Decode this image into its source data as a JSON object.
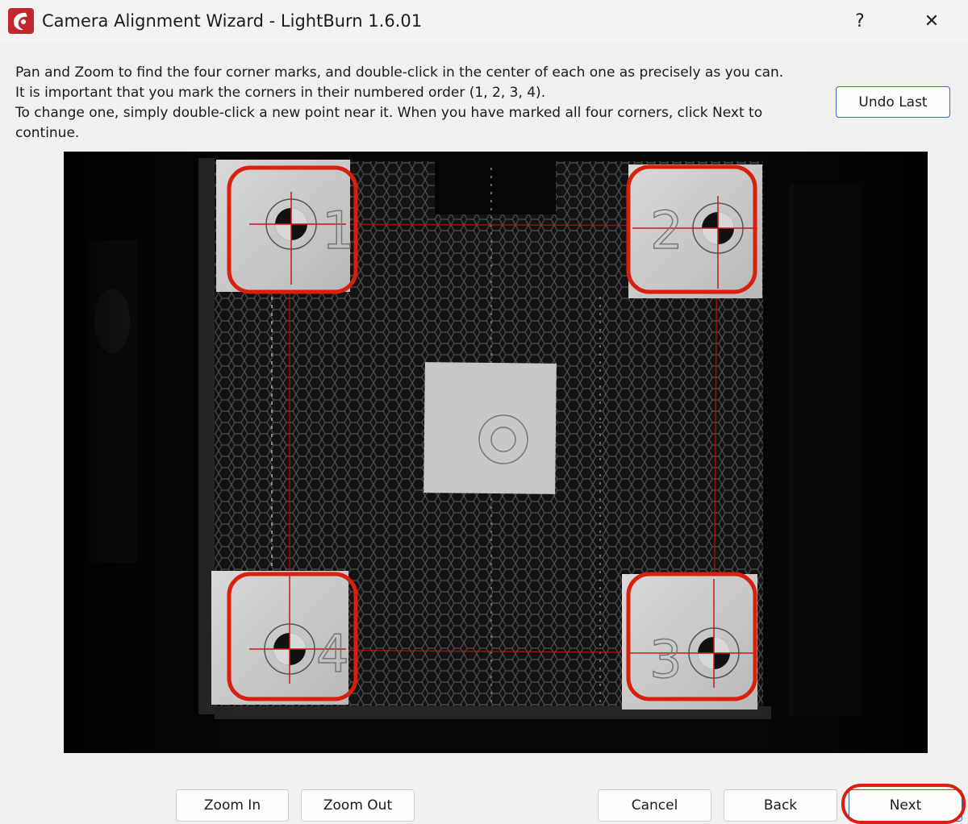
{
  "window": {
    "title": "Camera Alignment Wizard - LightBurn 1.6.01",
    "help_label": "?",
    "close_label": "✕"
  },
  "instructions": [
    "Pan and Zoom to find the four corner marks, and double-click in the center of each one as precisely as you can.",
    "It is important that you mark the corners in their numbered order (1, 2, 3, 4).",
    "To change one, simply double-click a new point near it.  When you have marked all four corners, click Next to",
    "continue."
  ],
  "buttons": {
    "undo_last": "Undo Last",
    "zoom_in": "Zoom In",
    "zoom_out": "Zoom Out",
    "cancel": "Cancel",
    "back": "Back",
    "next": "Next"
  },
  "corner_marks": [
    {
      "number": "1",
      "position": "top-left"
    },
    {
      "number": "2",
      "position": "top-right"
    },
    {
      "number": "3",
      "position": "bottom-right"
    },
    {
      "number": "4",
      "position": "bottom-left"
    }
  ],
  "colors": {
    "highlight": "#d9200f",
    "accent": "#2a6fb7"
  }
}
